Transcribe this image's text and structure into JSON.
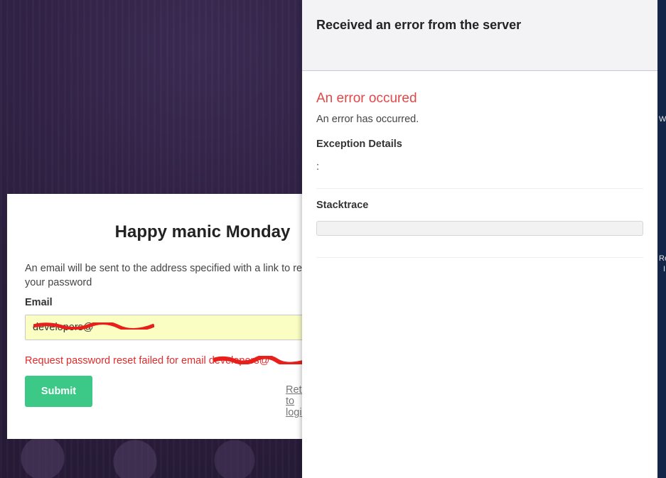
{
  "login": {
    "title": "Happy manic Monday",
    "description": "An email will be sent to the address specified with a link to reset your password",
    "email_label": "Email",
    "email_value": "developers@",
    "error_message": "Request password reset failed for email developers@",
    "submit_label": "Submit",
    "return_link": "Return to login"
  },
  "error_panel": {
    "title": "Received an error from the server",
    "heading": "An error occured",
    "message": "An error has occurred.",
    "exception_label": "Exception Details",
    "exception_value": ":",
    "stacktrace_label": "Stacktrace"
  },
  "edge": {
    "char_top": "W",
    "char_mid": "Re",
    "char_low": "I"
  },
  "colors": {
    "submit_bg": "#3cc886",
    "error_red": "#e02b2b",
    "heading_red": "#e04848",
    "input_bg": "#fafec3",
    "background": "#2a1d3c"
  }
}
